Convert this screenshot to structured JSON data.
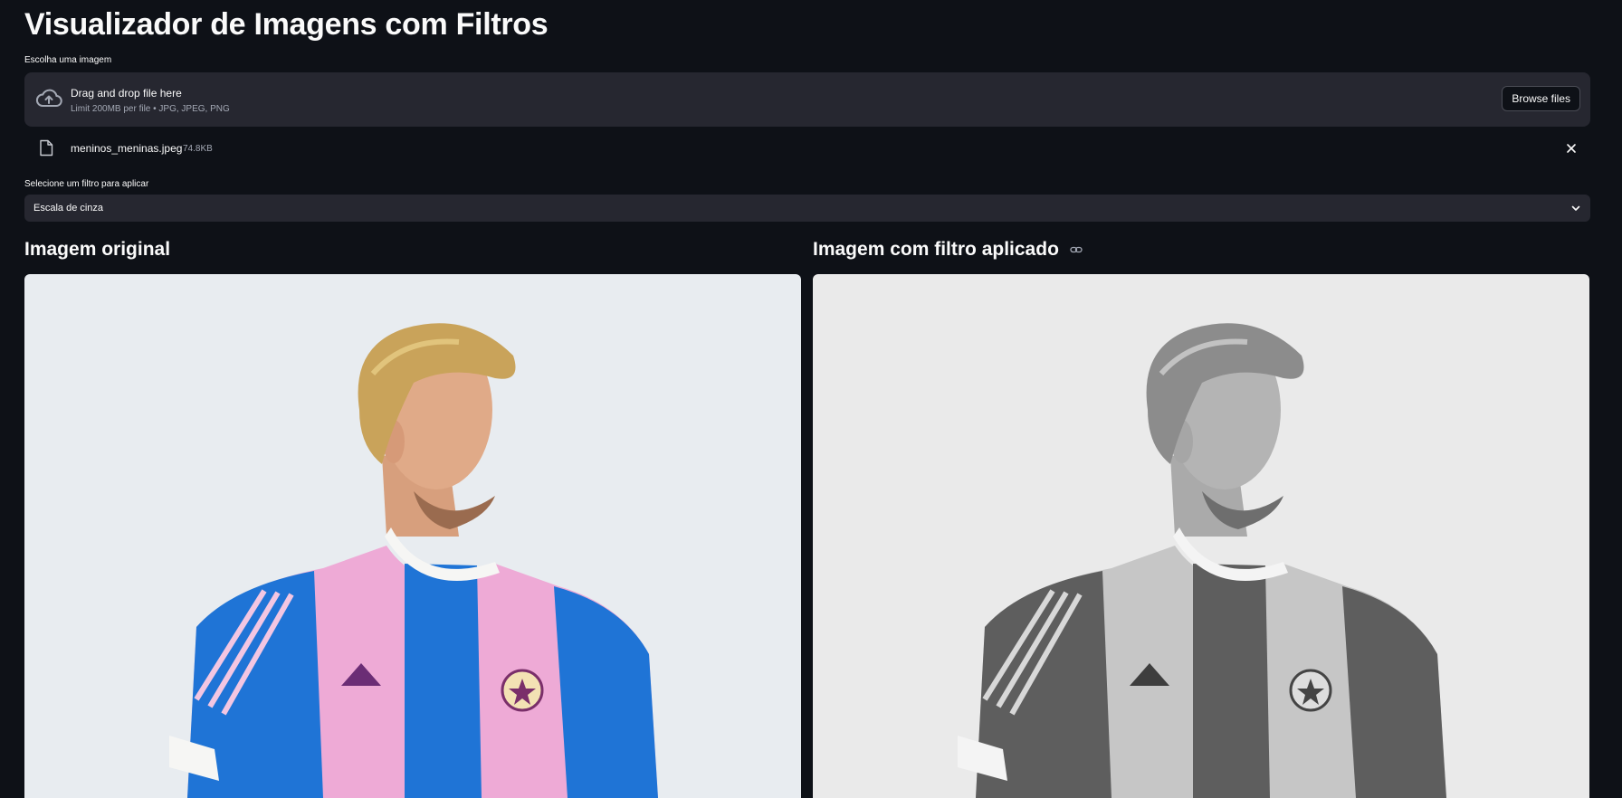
{
  "page": {
    "title": "Visualizador de Imagens com Filtros"
  },
  "uploader": {
    "label": "Escolha uma imagem",
    "drag_text": "Drag and drop file here",
    "limit_text": "Limit 200MB per file • JPG, JPEG, PNG",
    "browse_label": "Browse files",
    "icon": "cloud-upload-icon"
  },
  "uploaded_file": {
    "name": "meninos_meninas.jpeg",
    "size": "74.8KB",
    "icon": "file-icon",
    "remove_icon": "close-icon"
  },
  "filter_select": {
    "label": "Selecione um filtro para aplicar",
    "selected": "Escala de cinza",
    "icon": "chevron-down-icon"
  },
  "columns": {
    "original_title": "Imagem original",
    "filtered_title": "Imagem com filtro aplicado",
    "filtered_title_icon": "link-icon"
  },
  "colors": {
    "background": "#0e1117",
    "widget_bg": "#262730",
    "text": "#fafafa",
    "muted_text": "#a3a8b4",
    "shirt_blue": "#1f74d6",
    "shirt_pink": "#eeaad6"
  }
}
